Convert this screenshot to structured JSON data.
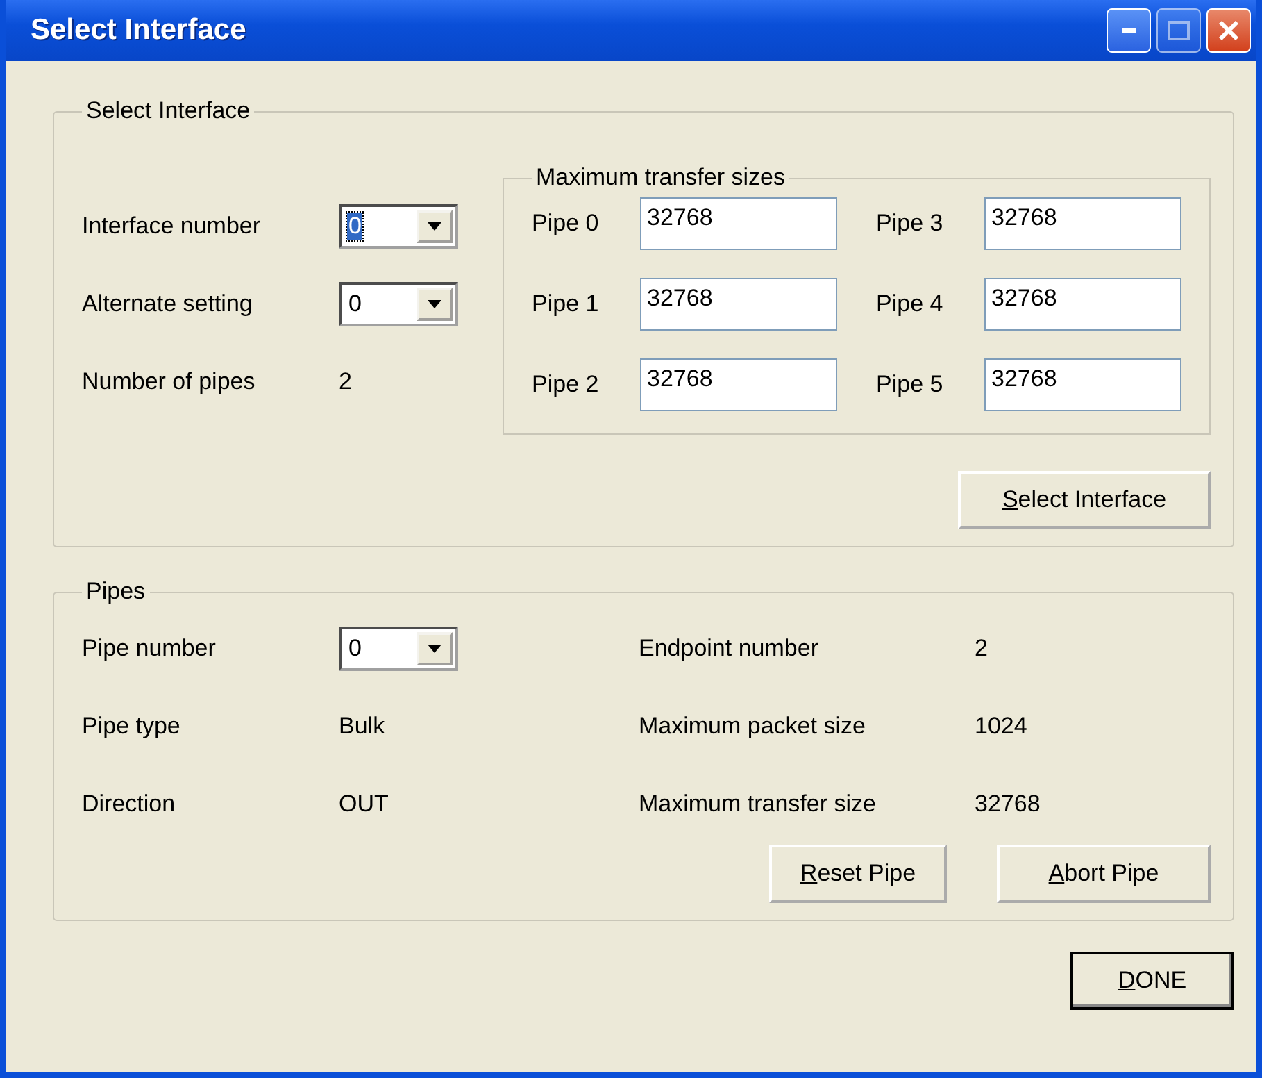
{
  "window": {
    "title": "Select Interface"
  },
  "interface_group": {
    "title": "Select Interface",
    "fields": [
      {
        "kind": "combo",
        "label": "Interface number",
        "value": "0",
        "selected": true
      },
      {
        "kind": "combo",
        "label": "Alternate setting",
        "value": "0",
        "selected": false
      },
      {
        "kind": "text",
        "label": "Number of pipes",
        "value": "2"
      }
    ],
    "transfer_sizes": {
      "title": "Maximum transfer sizes",
      "pipes": [
        {
          "label": "Pipe 0",
          "value": "32768"
        },
        {
          "label": "Pipe 1",
          "value": "32768"
        },
        {
          "label": "Pipe 2",
          "value": "32768"
        },
        {
          "label": "Pipe 3",
          "value": "32768"
        },
        {
          "label": "Pipe 4",
          "value": "32768"
        },
        {
          "label": "Pipe 5",
          "value": "32768"
        }
      ]
    },
    "button": {
      "key": "S",
      "rest": "elect Interface"
    }
  },
  "pipes_group": {
    "title": "Pipes",
    "left": [
      {
        "kind": "combo",
        "label": "Pipe number",
        "value": "0",
        "selected": false
      },
      {
        "kind": "text",
        "label": "Pipe type",
        "value": "Bulk"
      },
      {
        "kind": "text",
        "label": "Direction",
        "value": "OUT"
      }
    ],
    "right": [
      {
        "label": "Endpoint number",
        "value": "2"
      },
      {
        "label": "Maximum packet size",
        "value": "1024"
      },
      {
        "label": "Maximum transfer size",
        "value": "32768"
      }
    ],
    "buttons": [
      {
        "key": "R",
        "rest": "eset Pipe"
      },
      {
        "key": "A",
        "rest": "bort Pipe"
      }
    ]
  },
  "done_button": {
    "key": "D",
    "rest": "ONE"
  }
}
